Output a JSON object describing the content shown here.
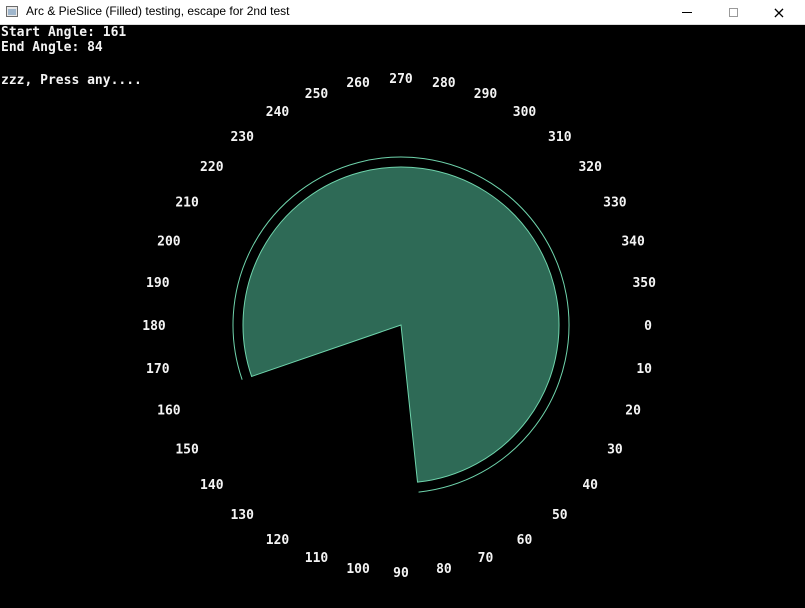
{
  "window": {
    "title": "Arc & PieSlice (Filled) testing, escape for 2nd test",
    "buttons": {
      "minimize": "minimize-icon",
      "maximize": "maximize-icon",
      "close": "×"
    }
  },
  "console": {
    "start_label": "Start Angle: 161",
    "end_label": "End Angle: 84",
    "prompt": "zzz, Press any...."
  },
  "dial": {
    "start_angle": 161,
    "end_angle": 84,
    "fill_color": "#2e6a56",
    "outline_color": "#6fd4ac",
    "label_color": "#f4f4f4",
    "labels": [
      "0",
      "10",
      "20",
      "30",
      "40",
      "50",
      "60",
      "70",
      "80",
      "90",
      "100",
      "110",
      "120",
      "130",
      "140",
      "150",
      "160",
      "170",
      "180",
      "190",
      "200",
      "210",
      "220",
      "230",
      "240",
      "250",
      "260",
      "270",
      "280",
      "290",
      "300",
      "310",
      "320",
      "330",
      "340",
      "350"
    ]
  }
}
